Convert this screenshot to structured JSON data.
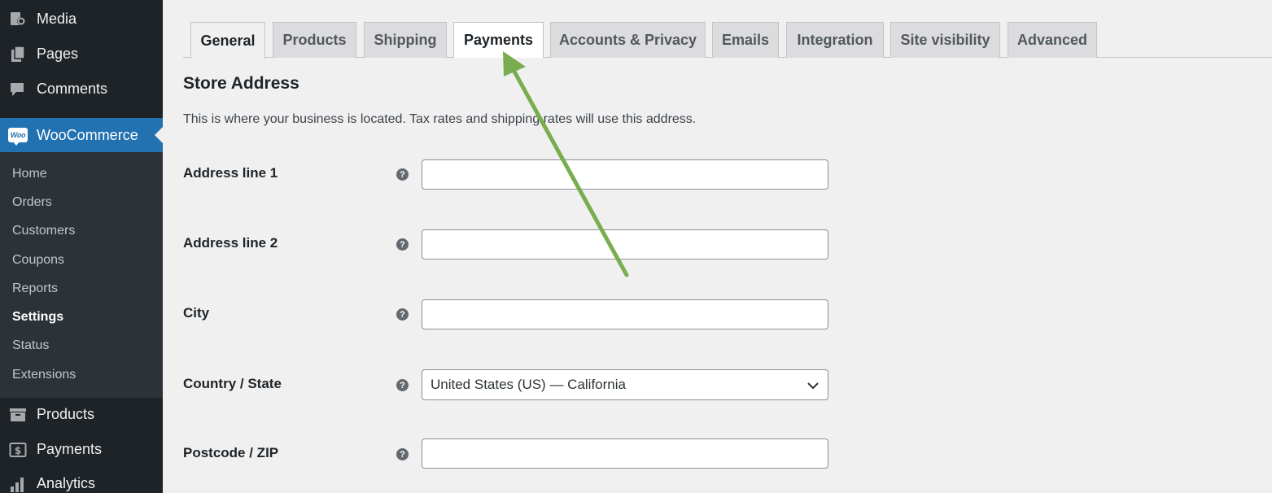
{
  "sidebar": {
    "top_items": [
      {
        "label": "Media",
        "icon": "media-icon"
      },
      {
        "label": "Pages",
        "icon": "pages-icon"
      },
      {
        "label": "Comments",
        "icon": "comments-icon"
      }
    ],
    "woocommerce": {
      "label": "WooCommerce",
      "logo_text": "Woo"
    },
    "submenu": [
      {
        "label": "Home"
      },
      {
        "label": "Orders"
      },
      {
        "label": "Customers"
      },
      {
        "label": "Coupons"
      },
      {
        "label": "Reports"
      },
      {
        "label": "Settings",
        "current": true
      },
      {
        "label": "Status"
      },
      {
        "label": "Extensions"
      }
    ],
    "bottom_items": [
      {
        "label": "Products",
        "icon": "archive-icon"
      },
      {
        "label": "Payments",
        "icon": "dollar-icon"
      },
      {
        "label": "Analytics",
        "icon": "bar-chart-icon"
      }
    ]
  },
  "tabs": [
    {
      "label": "General",
      "state": "active"
    },
    {
      "label": "Products"
    },
    {
      "label": "Shipping"
    },
    {
      "label": "Payments",
      "state": "highlighted"
    },
    {
      "label": "Accounts & Privacy"
    },
    {
      "label": "Emails"
    },
    {
      "label": "Integration"
    },
    {
      "label": "Site visibility"
    },
    {
      "label": "Advanced"
    }
  ],
  "store_address": {
    "title": "Store Address",
    "description": "This is where your business is located. Tax rates and shipping rates will use this address.",
    "fields": {
      "address1": {
        "label": "Address line 1",
        "value": ""
      },
      "address2": {
        "label": "Address line 2",
        "value": ""
      },
      "city": {
        "label": "City",
        "value": ""
      },
      "country": {
        "label": "Country / State",
        "value": "United States (US) — California"
      },
      "postcode": {
        "label": "Postcode / ZIP",
        "value": ""
      }
    },
    "help_glyph": "?"
  },
  "colors": {
    "sidebar_bg": "#1d2327",
    "submenu_bg": "#2c3338",
    "accent": "#2271b1",
    "annotation_arrow": "#7aad4f"
  }
}
